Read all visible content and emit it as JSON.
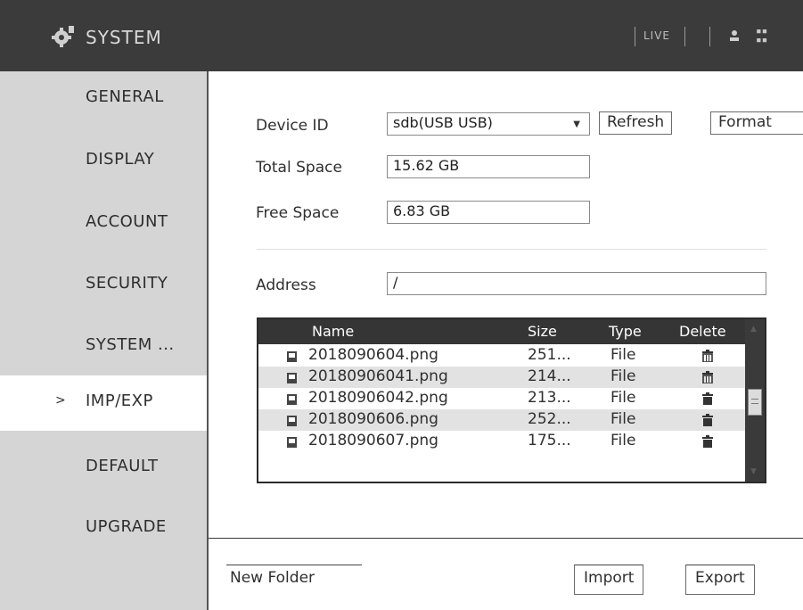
{
  "header": {
    "title": "SYSTEM",
    "live_label": "LIVE",
    "icons": [
      "gear-icon",
      "user-icon",
      "multi-screen-icon"
    ]
  },
  "sidebar": {
    "items": [
      {
        "label": "GENERAL",
        "active": false
      },
      {
        "label": "DISPLAY",
        "active": false
      },
      {
        "label": "ACCOUNT",
        "active": false
      },
      {
        "label": "SECURITY",
        "active": false
      },
      {
        "label": "SYSTEM ...",
        "active": false
      },
      {
        "label": "IMP/EXP",
        "active": true
      },
      {
        "label": "DEFAULT",
        "active": false
      },
      {
        "label": "UPGRADE",
        "active": false
      }
    ],
    "active_marker": ">"
  },
  "form": {
    "device_id_label": "Device ID",
    "device_id_value": "sdb(USB USB)",
    "refresh_label": "Refresh",
    "format_label": "Format",
    "total_space_label": "Total Space",
    "total_space_value": "15.62 GB",
    "free_space_label": "Free Space",
    "free_space_value": "6.83 GB",
    "address_label": "Address",
    "address_value": "/"
  },
  "file_table": {
    "columns": [
      "Name",
      "Size",
      "Type",
      "Delete"
    ],
    "rows": [
      {
        "name": "2018090604.png",
        "size": "251...",
        "type": "File"
      },
      {
        "name": "20180906041.png",
        "size": "214...",
        "type": "File"
      },
      {
        "name": "20180906042.png",
        "size": "213...",
        "type": "File"
      },
      {
        "name": "2018090606.png",
        "size": "252...",
        "type": "File"
      },
      {
        "name": "2018090607.png",
        "size": "175...",
        "type": "File"
      }
    ]
  },
  "footer": {
    "new_folder_label": "New Folder",
    "import_label": "Import",
    "export_label": "Export"
  },
  "colors": {
    "header_bg": "#3b3b3b",
    "sidebar_bg": "#d5d5d5",
    "table_header_bg": "#353535",
    "alt_row_bg": "#e2e2e2"
  }
}
